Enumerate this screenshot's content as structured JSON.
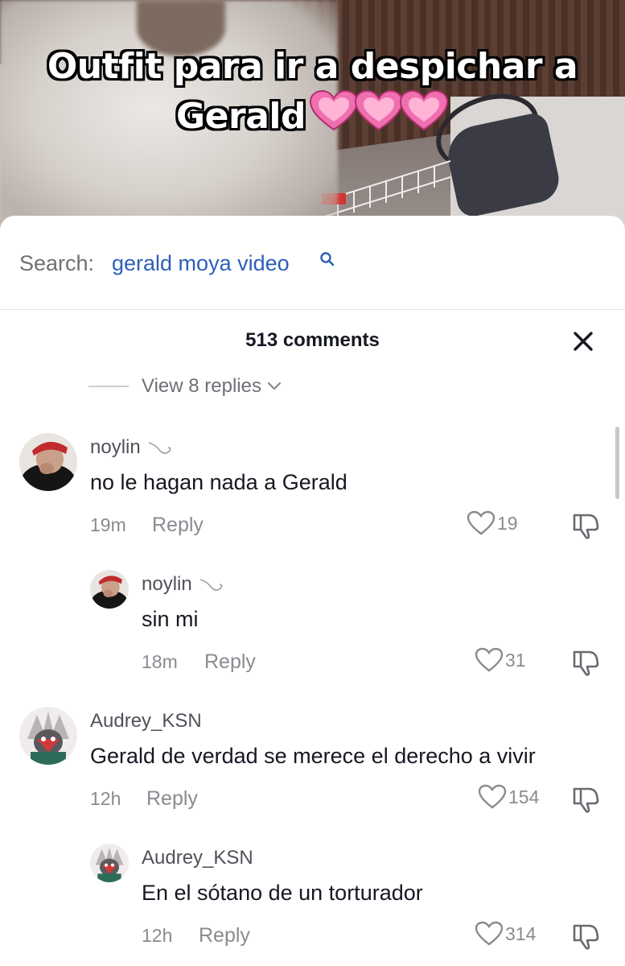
{
  "video": {
    "caption": "Outfit para ir a despichar a Gerald",
    "caption_line1": "Outfit para ir a despichar a",
    "caption_line2": "Gerald",
    "emoji": "heart-icon x3"
  },
  "search": {
    "label": "Search:",
    "query": "gerald moya video"
  },
  "comments_header": {
    "title": "513 comments"
  },
  "view_replies": {
    "label": "View 8 replies"
  },
  "comments": [
    {
      "username": "noylin",
      "text": "no le hagan nada a Gerald",
      "time": "19m",
      "reply_label": "Reply",
      "likes": "19"
    },
    {
      "username": "noylin",
      "text": "sin mi",
      "time": "18m",
      "reply_label": "Reply",
      "likes": "31"
    },
    {
      "username": "Audrey_KSN",
      "text": "Gerald de verdad se merece el derecho a vivir",
      "time": "12h",
      "reply_label": "Reply",
      "likes": "154"
    },
    {
      "username": "Audrey_KSN",
      "text": "En el sótano de un torturador",
      "time": "12h",
      "reply_label": "Reply",
      "likes": "314"
    }
  ],
  "colors": {
    "link_blue": "#2d5fb8",
    "text_primary": "#161823",
    "text_secondary": "#8a8b91",
    "heart_pink": "#f06fb0"
  }
}
